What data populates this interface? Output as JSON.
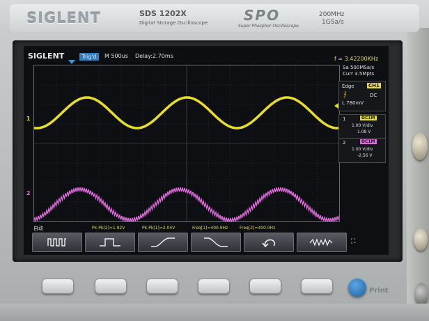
{
  "device": {
    "brand": "SIGLENT",
    "model": "SDS 1202X",
    "model_subtitle": "Digital Storage Oscilloscope",
    "technology_logo": "SPO",
    "technology_subtitle": "Super Phosphor Oscilloscope",
    "bandwidth": "200MHz",
    "sample_rate_spec": "1GSa/s",
    "print_button_label": "Print"
  },
  "screen": {
    "brand": "SIGLENT",
    "trigger_state": "Trig'd",
    "timebase": "M 500us",
    "delay": "Delay:2.70ms",
    "frequency_readout": "f = 3.42200KHz",
    "sample_rate": "Sa 500MSa/s",
    "memory_depth": "Curr 3.5Mpts",
    "trigger": {
      "type": "Edge",
      "source": "CH1",
      "slope_symbol": "⨍",
      "coupling": "DC",
      "level": "L  780mV"
    },
    "channels": [
      {
        "num": "1",
        "coupling": "DC1M",
        "vdiv": "1.00 V/div",
        "offset": "1.08 V",
        "color": "#e8dc2a"
      },
      {
        "num": "2",
        "coupling": "DC1M",
        "vdiv": "1.00 V/div",
        "offset": "-2.56 V",
        "color": "#e36be0"
      }
    ],
    "channel_markers": {
      "ch1": "1",
      "ch2": "2"
    },
    "measurements": {
      "mode": "自动",
      "items": [
        "Pk-Pk[2]=1.92V",
        "Pk-Pk[1]=2.04V",
        "Freq[1]=400.9Hz",
        "Freq[2]=400.0Hz"
      ]
    },
    "softkeys": [
      {
        "icon": "square-wave-icon"
      },
      {
        "icon": "pulse-wave-icon"
      },
      {
        "icon": "rise-edge-icon"
      },
      {
        "icon": "fall-edge-icon"
      },
      {
        "icon": "undo-arrow-icon"
      },
      {
        "icon": "noise-wave-icon"
      }
    ],
    "usb_indicator": "usb-icon"
  },
  "colors": {
    "ch1": "#e8dc2a",
    "ch2": "#e36be0",
    "accent": "#2e7fc0"
  }
}
